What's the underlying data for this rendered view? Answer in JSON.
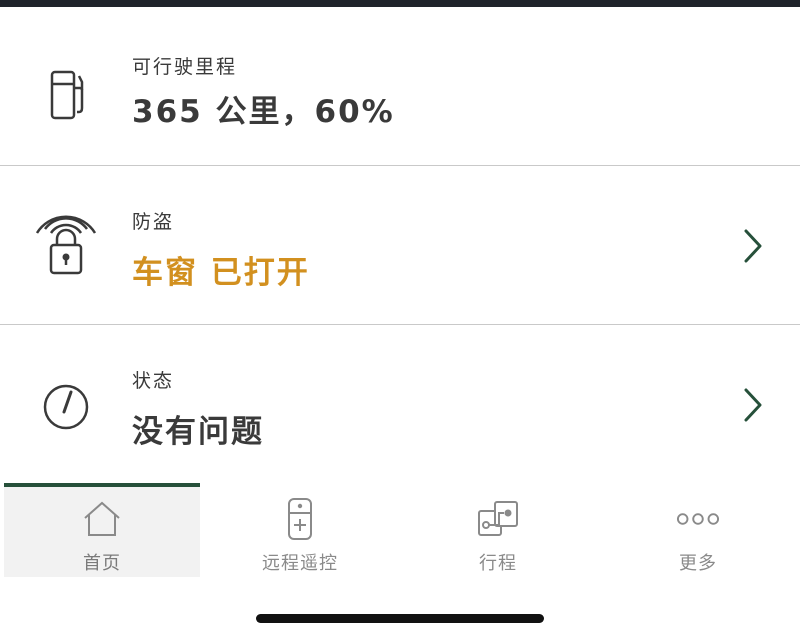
{
  "cards": [
    {
      "icon": "fuel-pump-icon",
      "label": "可行驶里程",
      "value": "365 公里，60%",
      "status": "normal"
    },
    {
      "icon": "alarm-lock-icon",
      "label": "防盗",
      "value": "车窗 已打开",
      "status": "warning"
    },
    {
      "icon": "gauge-icon",
      "label": "状态",
      "value": "没有问题",
      "status": "normal"
    }
  ],
  "tabs": [
    {
      "icon": "home-icon",
      "label": "首页",
      "active": true
    },
    {
      "icon": "remote-control-icon",
      "label": "远程遥控",
      "active": false
    },
    {
      "icon": "trips-icon",
      "label": "行程",
      "active": false
    },
    {
      "icon": "more-icon",
      "label": "更多",
      "active": false
    }
  ],
  "colors": {
    "warning": "#d2901f",
    "accent": "#26503a",
    "text": "#3a3a3a",
    "muted": "#8a8a8a"
  }
}
